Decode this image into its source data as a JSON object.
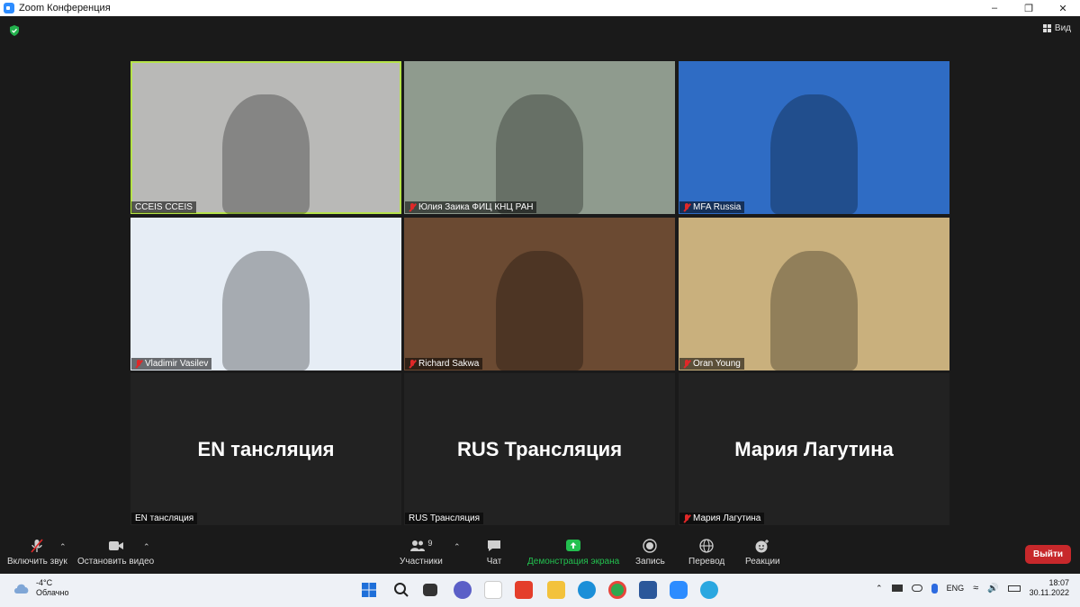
{
  "window": {
    "title": "Zoom Конференция"
  },
  "view": {
    "label": "Вид"
  },
  "tiles": [
    {
      "name": "CCEIS CCEIS",
      "muted": false,
      "active": true,
      "bg": "#b9b9b7"
    },
    {
      "name": "Юлия Заика ФИЦ КНЦ РАН",
      "muted": true,
      "bg": "#8f9b8e"
    },
    {
      "name": "MFA Russia",
      "muted": true,
      "bg": "#2f6cc4"
    },
    {
      "name": "Vladimir Vasilev",
      "muted": true,
      "bg": "#e6edf5"
    },
    {
      "name": "Richard Sakwa",
      "muted": true,
      "bg": "#6b4a32"
    },
    {
      "name": "Oran Young",
      "muted": true,
      "bg": "#c9b07d"
    },
    {
      "name": "EN тансляция",
      "muted": false,
      "big": "EN тансляция",
      "bg": "#222222"
    },
    {
      "name": "RUS Трансляция",
      "muted": false,
      "big": "RUS Трансляция",
      "bg": "#222222"
    },
    {
      "name": "Мария Лагутина",
      "muted": true,
      "big": "Мария Лагутина",
      "bg": "#222222"
    }
  ],
  "toolbar": {
    "unmute": "Включить звук",
    "stop_video": "Остановить видео",
    "participants": "Участники",
    "participants_count": "9",
    "chat": "Чат",
    "share": "Демонстрация экрана",
    "record": "Запись",
    "translate": "Перевод",
    "reactions": "Реакции",
    "leave": "Выйти",
    "share_color": "#23c04f"
  },
  "taskbar": {
    "temp": "-4°C",
    "weather": "Облачно",
    "lang": "ENG",
    "time": "18:07",
    "date": "30.11.2022"
  }
}
